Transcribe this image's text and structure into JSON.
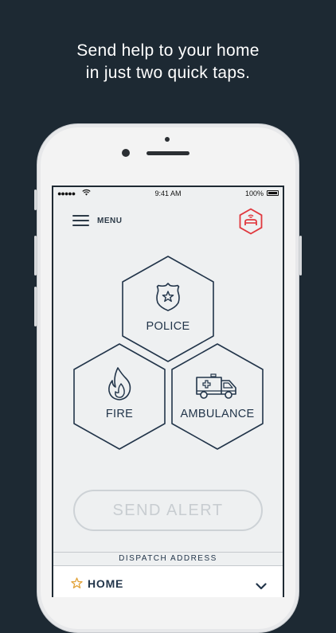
{
  "promo": {
    "line1": "Send help to your home",
    "line2": "in just two quick taps."
  },
  "statusbar": {
    "signal": "●●●●●",
    "time": "9:41 AM",
    "battery": "100%"
  },
  "header": {
    "menu_label": "MENU",
    "logo_icon": "shield-car-logo-icon"
  },
  "services": [
    {
      "label": "POLICE",
      "icon": "police-badge-icon"
    },
    {
      "label": "FIRE",
      "icon": "flame-icon"
    },
    {
      "label": "AMBULANCE",
      "icon": "ambulance-icon"
    }
  ],
  "send_alert": {
    "label": "SEND ALERT"
  },
  "dispatch": {
    "title": "DISPATCH ADDRESS",
    "selected": "HOME"
  },
  "colors": {
    "background": "#1d2933",
    "primary": "#22354a",
    "accent_red": "#e0383e",
    "star": "#e2a33a",
    "disabled": "#c8cdd1"
  }
}
